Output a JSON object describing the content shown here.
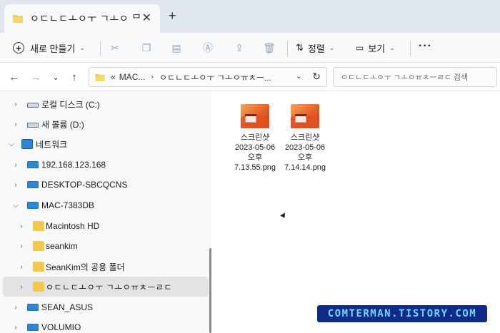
{
  "window": {
    "tab_title": "ㅇㄷㄴㄷㅗㅇㅜ ㄱㅗㅇ ᄆ",
    "tab_close_icon": "close-icon",
    "new_tab_symbol": "+"
  },
  "toolbar": {
    "new_label": "새로 만들기",
    "sort_label": "정렬",
    "view_label": "보기",
    "more_symbol": "···"
  },
  "address": {
    "overflow": "«",
    "segment_1": "MAC...",
    "chevron": "›",
    "segment_2": "ㅇㄷㄴㄷㅗㅇㅜ ㄱㅗㅇㅠㅊㅡ...",
    "search_placeholder": "ㅇㄷㄴㄷㅗㅇㅜ ㄱㅗㅇㅠㅊㅡㄹㄷ 검색"
  },
  "sidebar": {
    "items": [
      {
        "label": "로컬 디스크 (C:)",
        "icon": "drive-icon",
        "expander": "›"
      },
      {
        "label": "새 볼륨 (D:)",
        "icon": "drive-icon",
        "expander": "›"
      },
      {
        "label": "네트워크",
        "icon": "network-icon",
        "expander": "⌵"
      },
      {
        "label": "192.168.123.168",
        "icon": "computer-icon",
        "expander": "›"
      },
      {
        "label": "DESKTOP-SBCQCNS",
        "icon": "computer-icon",
        "expander": "›"
      },
      {
        "label": "MAC-7383DB",
        "icon": "computer-icon",
        "expander": "⌵"
      },
      {
        "label": "Macintosh HD",
        "icon": "folder-icon",
        "expander": "›"
      },
      {
        "label": "seankim",
        "icon": "folder-icon",
        "expander": "›"
      },
      {
        "label": "SeanKim의 공용 폴더",
        "icon": "folder-icon",
        "expander": "›"
      },
      {
        "label": "ㅇㄷㄴㄷㅗㅇㅜ ㄱㅗㅇㅠㅊㅡㄹㄷ",
        "icon": "folder-icon",
        "expander": "›",
        "selected": true
      },
      {
        "label": "SEAN_ASUS",
        "icon": "computer-icon",
        "expander": "›"
      },
      {
        "label": "VOLUMIO",
        "icon": "computer-icon",
        "expander": "›"
      }
    ]
  },
  "files": [
    {
      "line1": "스크린샷",
      "line2": "2023-05-06",
      "line3": "오후",
      "line4": "7.13.55.png"
    },
    {
      "line1": "스크린샷",
      "line2": "2023-05-06",
      "line3": "오후",
      "line4": "7.14.14.png"
    }
  ],
  "watermark": "COMTERMAN.TISTORY.COM",
  "colors": {
    "accent": "#2f86d6",
    "folder": "#f2c94c",
    "watermark_bg": "#0f2a88",
    "watermark_text": "#6fd8ff"
  }
}
